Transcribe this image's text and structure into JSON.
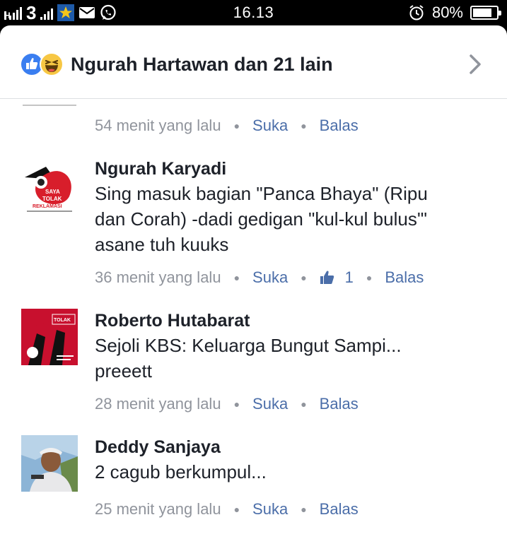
{
  "status_bar": {
    "carrier_label": "3",
    "time": "16.13",
    "battery": "80%",
    "battery_level": 0.8,
    "icons": [
      "signal-icon",
      "star-icon",
      "mail-icon",
      "whatsapp-icon",
      "alarm-icon",
      "battery-icon"
    ]
  },
  "header": {
    "reactions": [
      "like",
      "haha"
    ],
    "title": "Ngurah Hartawan dan 21 lain"
  },
  "actions": {
    "like": "Suka",
    "reply": "Balas"
  },
  "first_partial": {
    "time": "54 menit yang lalu"
  },
  "comments": [
    {
      "name": "Ngurah Karyadi",
      "lines": [
        "Sing masuk bagian \"Panca Bhaya\" (Ripu",
        "dan Corah) -dadi gedigan \"kul-kul bulus'\"",
        "asane tuh kuuks"
      ],
      "time": "36 menit yang lalu",
      "likes": "1"
    },
    {
      "name": "Roberto Hutabarat",
      "lines": [
        "Sejoli KBS: Keluarga Bungut Sampi...",
        "preeett"
      ],
      "time": "28 menit yang lalu"
    },
    {
      "name": "Deddy Sanjaya",
      "lines": [
        "2 cagub berkumpul..."
      ],
      "time": "25 menit yang lalu"
    }
  ],
  "colors": {
    "link": "#4b6ea9",
    "meta": "#90949c",
    "text": "#1d2129",
    "like_blue": "#3a7ef0"
  }
}
